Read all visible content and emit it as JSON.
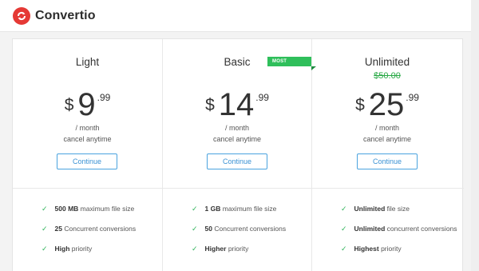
{
  "app": {
    "name": "Convertio"
  },
  "colors": {
    "brand": "#e53935",
    "accent": "#27a844",
    "link": "#3a92d4"
  },
  "plans": [
    {
      "name": "Light",
      "currency": "$",
      "amount": "9",
      "cents": ".99",
      "per": "/ month",
      "cancel": "cancel anytime",
      "button": "Continue",
      "features": [
        {
          "bold": "500 MB",
          "text": " maximum file size"
        },
        {
          "bold": "25",
          "text": " Concurrent conversions"
        },
        {
          "bold": "High",
          "text": " priority"
        }
      ]
    },
    {
      "name": "Basic",
      "badge": "MOST POPULAR",
      "currency": "$",
      "amount": "14",
      "cents": ".99",
      "per": "/ month",
      "cancel": "cancel anytime",
      "button": "Continue",
      "features": [
        {
          "bold": "1 GB",
          "text": " maximum file size"
        },
        {
          "bold": "50",
          "text": " Concurrent conversions"
        },
        {
          "bold": "Higher",
          "text": " priority"
        }
      ]
    },
    {
      "name": "Unlimited",
      "old_price": "$50.00",
      "currency": "$",
      "amount": "25",
      "cents": ".99",
      "per": "/ month",
      "cancel": "cancel anytime",
      "button": "Continue",
      "features": [
        {
          "bold": "Unlimited",
          "text": " file size"
        },
        {
          "bold": "Unlimited",
          "text": " concurrent conversions"
        },
        {
          "bold": "Highest",
          "text": " priority"
        }
      ]
    }
  ]
}
